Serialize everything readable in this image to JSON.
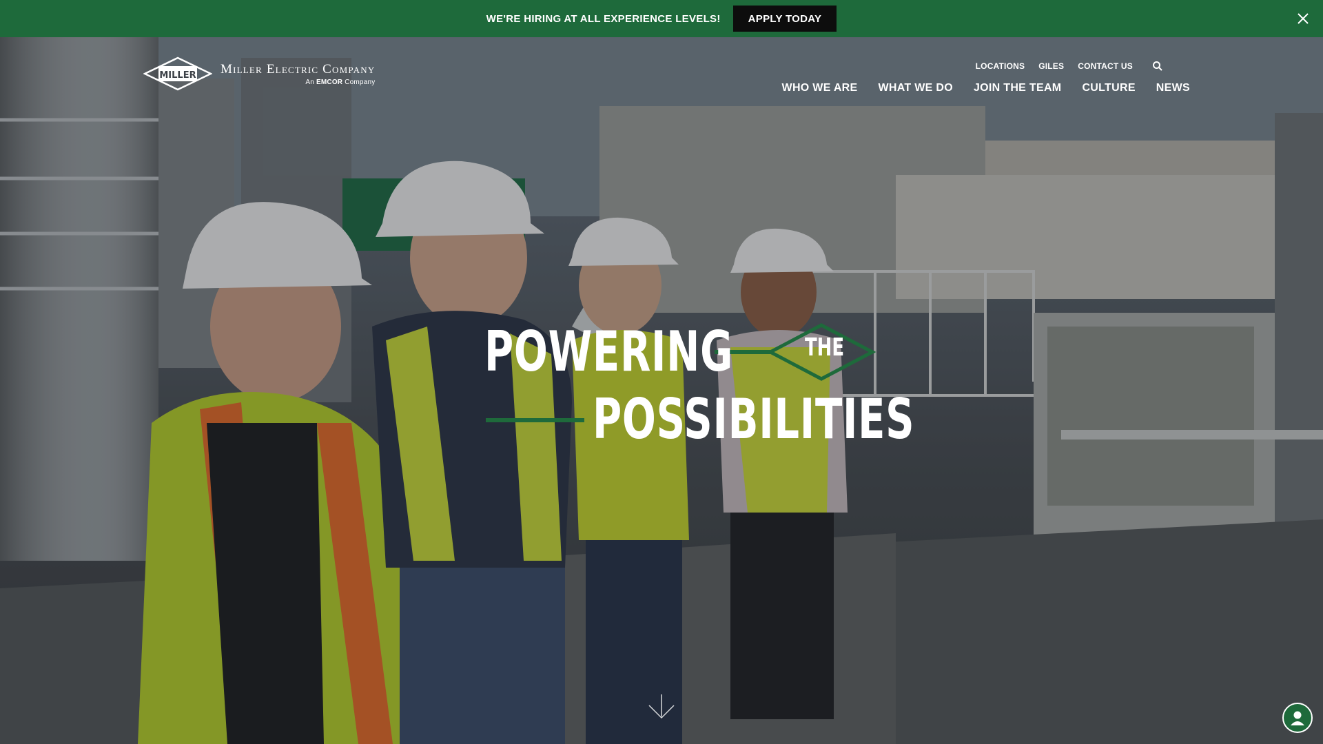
{
  "banner": {
    "text": "WE'RE HIRING AT ALL EXPERIENCE LEVELS!",
    "button_label": "APPLY TODAY",
    "close_icon": "close-icon",
    "background": "#1e6a3b"
  },
  "logo": {
    "emblem_text": "MILLER",
    "name": "Miller Electric Company",
    "sub_prefix": "An",
    "sub_brand": "EMCOR",
    "sub_suffix": "Company"
  },
  "utility_nav": {
    "items": [
      "LOCATIONS",
      "GILES",
      "CONTACT US"
    ],
    "search_icon": "search-icon"
  },
  "main_nav": {
    "items": [
      "WHO WE ARE",
      "WHAT WE DO",
      "JOIN THE TEAM",
      "CULTURE",
      "NEWS"
    ]
  },
  "hero": {
    "line1": "POWERING",
    "connector": "THE",
    "line2": "POSSIBILITIES",
    "accent_color": "#1e6a3b",
    "scroll_icon": "arrow-down-icon",
    "account_icon": "user-icon"
  }
}
